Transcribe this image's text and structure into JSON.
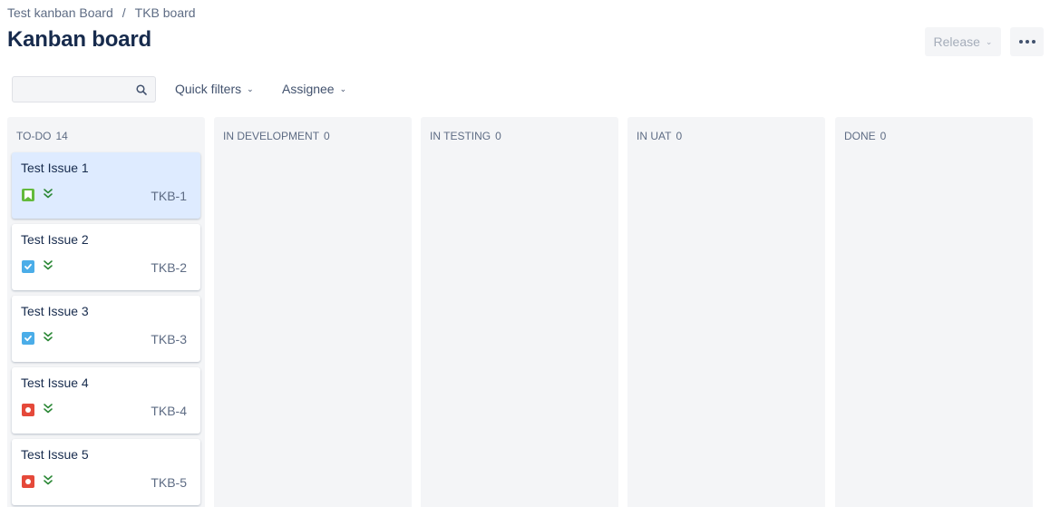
{
  "breadcrumb": {
    "project": "Test kanban Board",
    "separator": "/",
    "board": "TKB board"
  },
  "page": {
    "title": "Kanban board"
  },
  "toolbar": {
    "release_label": "Release",
    "more_icon": "more-icon"
  },
  "filters": {
    "search_placeholder": "",
    "quick_filters_label": "Quick filters",
    "assignee_label": "Assignee"
  },
  "colors": {
    "story": "#63ba3c",
    "task": "#4bade8",
    "bug": "#e5493a",
    "priority_low": "#2a8735",
    "selected_card": "#deebff"
  },
  "columns": [
    {
      "name": "TO-DO",
      "count": "14"
    },
    {
      "name": "IN DEVELOPMENT",
      "count": "0"
    },
    {
      "name": "IN TESTING",
      "count": "0"
    },
    {
      "name": "IN UAT",
      "count": "0"
    },
    {
      "name": "DONE",
      "count": "0"
    }
  ],
  "cards": [
    {
      "title": "Test Issue 1",
      "key": "TKB-1",
      "type": "story-icon",
      "priority": "lowest-priority-icon"
    },
    {
      "title": "Test Issue 2",
      "key": "TKB-2",
      "type": "task-icon",
      "priority": "lowest-priority-icon"
    },
    {
      "title": "Test Issue 3",
      "key": "TKB-3",
      "type": "task-icon",
      "priority": "lowest-priority-icon"
    },
    {
      "title": "Test Issue 4",
      "key": "TKB-4",
      "type": "bug-icon",
      "priority": "lowest-priority-icon"
    },
    {
      "title": "Test Issue 5",
      "key": "TKB-5",
      "type": "bug-icon",
      "priority": "lowest-priority-icon"
    }
  ]
}
